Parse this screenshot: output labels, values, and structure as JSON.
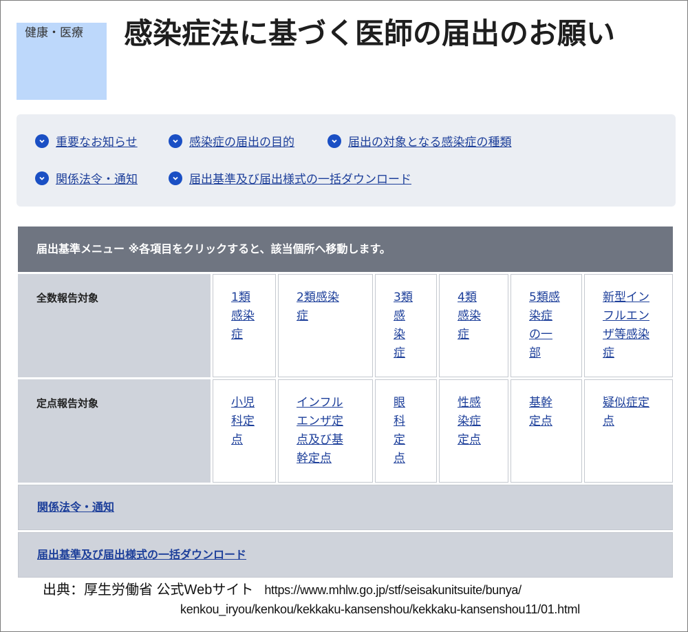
{
  "category_badge": "健康・医療",
  "page_title": "感染症法に基づく医師の届出のお願い",
  "toc": {
    "items": [
      "重要なお知らせ",
      "感染症の届出の目的",
      "届出の対象となる感染症の種類",
      "関係法令・通知",
      "届出基準及び届出様式の一括ダウンロード"
    ]
  },
  "menu": {
    "header": "届出基準メニュー ※各項目をクリックすると、該当個所へ移動します。",
    "rows": [
      {
        "label": "全数報告対象",
        "cells": [
          [
            "1類",
            "感染",
            "症"
          ],
          [
            "2類感染",
            "症"
          ],
          [
            "3類",
            "感",
            "染",
            "症"
          ],
          [
            "4類",
            "感染",
            "症"
          ],
          [
            "5類感",
            "染症",
            "の一",
            "部"
          ],
          [
            "新型イン",
            "フルエン",
            "ザ等感染",
            "症"
          ]
        ]
      },
      {
        "label": "定点報告対象",
        "cells": [
          [
            "小児",
            "科定",
            "点"
          ],
          [
            "インフル",
            "エンザ定",
            "点及び基",
            "幹定点"
          ],
          [
            "眼",
            "科",
            "定",
            "点"
          ],
          [
            "性感",
            "染症",
            "定点"
          ],
          [
            "基幹",
            "定点"
          ],
          [
            "疑似症定",
            "点"
          ]
        ]
      }
    ],
    "laws_link": "関係法令・通知",
    "download_link": "届出基準及び届出様式の一括ダウンロード"
  },
  "source": {
    "label": "出典：厚生労働省 公式Webサイト",
    "url_line1": "https://www.mhlw.go.jp/stf/seisakunitsuite/bunya/",
    "url_line2": "kenkou_iryou/kenkou/kekkaku-kansenshou/kekkaku-kansenshou11/01.html"
  },
  "colors": {
    "badge_bg": "#bdd8fb",
    "toc_bg": "#ebeef3",
    "menu_header_bg": "#6f7581",
    "row_label_bg": "#cfd3db",
    "link": "#1d3f9a",
    "bullet": "#1a4fc4"
  },
  "icons": {
    "toc_bullet": "chevron-down-circle-icon"
  }
}
